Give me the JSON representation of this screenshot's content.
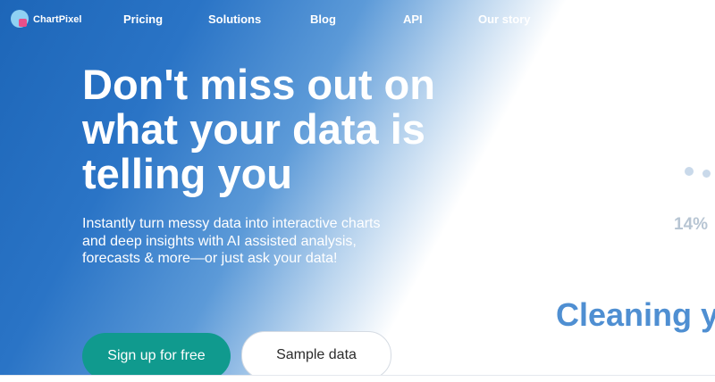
{
  "nav": {
    "logo_text": "ChartPixel",
    "links": [
      "Pricing",
      "Solutions",
      "Blog",
      "API",
      "Our story"
    ]
  },
  "hero": {
    "headline_lines": [
      "Don't miss out on",
      "what your data is",
      "telling you"
    ],
    "subtitle_lines": [
      "Instantly turn messy data into interactive charts",
      "and deep insights with AI assisted analysis,",
      "forecasts & more—or just ask your data!"
    ],
    "primary_cta": "Sign up for free",
    "secondary_cta": "Sample data"
  },
  "side_graphic": {
    "percent_label": "14%",
    "caption": "Cleaning yo"
  },
  "colors": {
    "brand_blue": "#1d66b8",
    "accent_teal": "#109a8e",
    "caption_blue": "#4f8fd2"
  },
  "icons": [
    "chartpixel-logo-icon"
  ]
}
